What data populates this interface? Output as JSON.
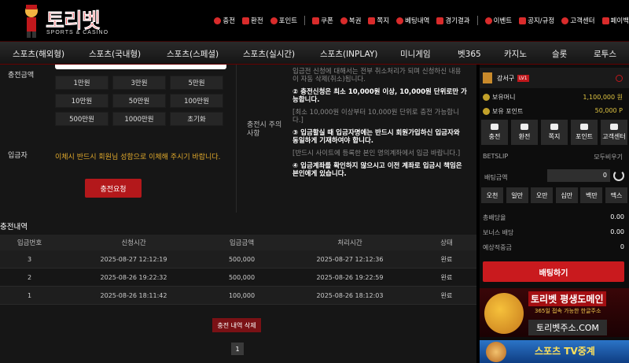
{
  "brand": {
    "name": "토리벳",
    "sub": "SPORTS & CASINO"
  },
  "topmenu": [
    "충전",
    "환전",
    "포인트",
    "쿠폰",
    "복권",
    "쪽지",
    "베팅내역",
    "경기결과",
    "이벤트",
    "공지/규정",
    "고객센터",
    "페이백"
  ],
  "nav": [
    "스포츠(해외형)",
    "스포츠(국내형)",
    "스포츠(스페셜)",
    "스포츠(실시간)",
    "스포츠(INPLAY)",
    "미니게임",
    "벳365",
    "카지노",
    "슬롯",
    "로투스"
  ],
  "form": {
    "amount_label": "충전금액",
    "amount_buttons": [
      "1만원",
      "3만원",
      "5만원",
      "10만원",
      "50만원",
      "100만원",
      "500만원",
      "1000만원",
      "초기화"
    ],
    "depositor_label": "입금자",
    "depositor_msg": "이체시 반드시 회원님 성함으로 이체해 주시기 바랍니다.",
    "submit_label": "충전요청"
  },
  "notice": {
    "label": "충전시 주의사항",
    "lines": [
      {
        "text": "입금전 신청에 대해서는 전부 취소처리가 되며 신청하신 내용이 자동 삭제(취소)됩니다.",
        "style": "dim"
      },
      {
        "text": "② 충전신청은 최소 10,000원 이상, 10,000원 단위로만 가능합니다.",
        "style": "bold"
      },
      {
        "text": "[최소 10,000원 이상부터 10,000원 단위로 충전 가능합니다.]",
        "style": "dim"
      },
      {
        "text": "③ 입금할실 때 입금자명에는 반드시 회원가입하신 입금자와 동일하게 기재하여야 합니다.",
        "style": "bold"
      },
      {
        "text": "[반드시 사이트에 등록한 본인 명의계좌에서 입금 바랍니다.]",
        "style": "dim"
      },
      {
        "text": "④ 입금계좌를 확인하지 않으시고 이전 계좌로 입금시 책임은 본인에게 있습니다.",
        "style": "bold"
      }
    ]
  },
  "history": {
    "title": "충전내역",
    "headers": [
      "입금번호",
      "신청시간",
      "입금금액",
      "처리시간",
      "상태"
    ],
    "rows": [
      [
        "3",
        "2025-08-27 12:12:19",
        "500,000",
        "2025-08-27 12:12:36",
        "완료"
      ],
      [
        "2",
        "2025-08-26 19:22:32",
        "500,000",
        "2025-08-26 19:22:59",
        "완료"
      ],
      [
        "1",
        "2025-08-26 18:11:42",
        "100,000",
        "2025-08-26 18:12:03",
        "완료"
      ]
    ],
    "delete_label": "충전 내역 삭제",
    "page": "1"
  },
  "sidebar": {
    "user_name": "강서구",
    "level": "LV1",
    "money_label": "보유머니",
    "money_value": "1,100,000 원",
    "point_label": "보유 포인트",
    "point_value": "50,000 P",
    "quick": [
      "충전",
      "환전",
      "쪽지",
      "포인트",
      "고객센터"
    ],
    "betslip_label": "BETSLIP",
    "clear_label": "모두비우기",
    "bet_amount_label": "배팅금액",
    "bet_amount_value": "0",
    "chips": [
      "오천",
      "일만",
      "오만",
      "십만",
      "백만",
      "맥스"
    ],
    "summary": [
      {
        "label": "총배당율",
        "value": "0.00"
      },
      {
        "label": "보너스 배당",
        "value": "0.00"
      },
      {
        "label": "예상적중금",
        "value": "0"
      }
    ],
    "bet_button": "배팅하기",
    "banner1": {
      "title": "토리벳 평생도메인",
      "sub": "365일 접속 가능한 한글주소",
      "url": "토리벳주소.COM"
    },
    "banner2": {
      "title": "스포츠 TV중계"
    }
  }
}
